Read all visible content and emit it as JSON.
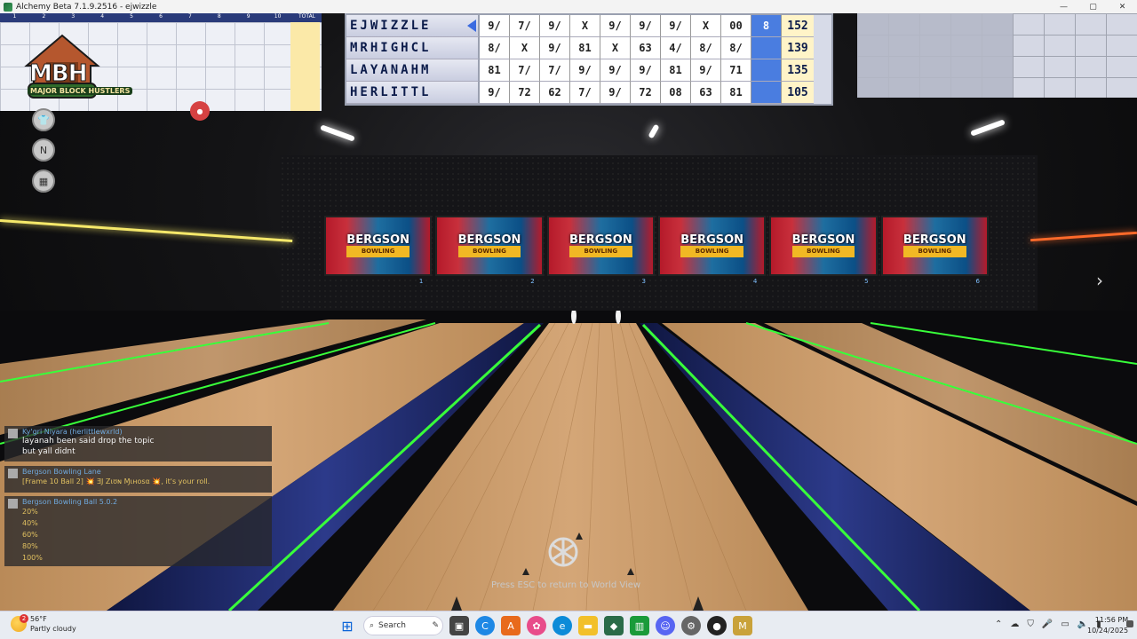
{
  "window": {
    "title": "Alchemy Beta 7.1.9.2516 - ejwizzle",
    "min_glyph": "—",
    "max_glyph": "▢",
    "close_glyph": "✕"
  },
  "scoreboard": {
    "players": [
      {
        "name": "EJWIZZLE",
        "frames": [
          "9/",
          "7/",
          "9/",
          "X",
          "9/",
          "9/",
          "9/",
          "X",
          "00",
          "8"
        ],
        "total": "152",
        "active": true
      },
      {
        "name": "MRHIGHCL",
        "frames": [
          "8/",
          "X",
          "9/",
          "81",
          "X",
          "63",
          "4/",
          "8/",
          "8/",
          ""
        ],
        "total": "139",
        "active": false
      },
      {
        "name": "LAYANAHM",
        "frames": [
          "81",
          "7/",
          "7/",
          "9/",
          "9/",
          "9/",
          "81",
          "9/",
          "71",
          ""
        ],
        "total": "135",
        "active": false
      },
      {
        "name": "HERLITTL",
        "frames": [
          "9/",
          "72",
          "62",
          "7/",
          "9/",
          "72",
          "08",
          "63",
          "81",
          ""
        ],
        "total": "105",
        "active": false
      }
    ]
  },
  "left_board": {
    "frame_numbers": [
      "1",
      "2",
      "3",
      "4",
      "5",
      "6",
      "7",
      "8",
      "9",
      "10",
      "TOTAL"
    ]
  },
  "logo": {
    "main": "MBH",
    "sub": "MAJOR BLOCK HUSTLERS"
  },
  "banners": [
    {
      "brand": "BERGSON",
      "sub": "BOWLING",
      "lane": "1"
    },
    {
      "brand": "BERGSON",
      "sub": "BOWLING",
      "lane": "2"
    },
    {
      "brand": "BERGSON",
      "sub": "BOWLING",
      "lane": "3"
    },
    {
      "brand": "BERGSON",
      "sub": "BOWLING",
      "lane": "4"
    },
    {
      "brand": "BERGSON",
      "sub": "BOWLING",
      "lane": "5"
    },
    {
      "brand": "BERGSON",
      "sub": "BOWLING",
      "lane": "6"
    }
  ],
  "chat": {
    "msg1": {
      "speaker": "Ky'gri Niyara (herlittlewxrld)",
      "lines": [
        "layanah been said drop the topic",
        "but yall didnt"
      ]
    },
    "msg2": {
      "speaker": "Bergson Bowling Lane",
      "line": "[Frame 10 Ball 2] 💥 ƎJ Zιʊɴ Ɱιʜosα 💥, it's your roll."
    },
    "msg3": {
      "speaker": "Bergson Bowling Ball 5.0.2",
      "options": [
        "20%",
        "40%",
        "60%",
        "80%",
        "100%"
      ]
    }
  },
  "esc_message": "Press ESC to return to World View",
  "taskbar": {
    "weather_temp": "56°F",
    "weather_desc": "Partly cloudy",
    "weather_badge": "2",
    "search_label": "Search",
    "time": "11:56 PM",
    "date": "10/24/2025"
  },
  "colors": {
    "lane_wood": "#c99a66",
    "gutter_blue": "#1f2a66",
    "neon_green": "#38ff3a",
    "score_blue": "#4a7de0"
  }
}
